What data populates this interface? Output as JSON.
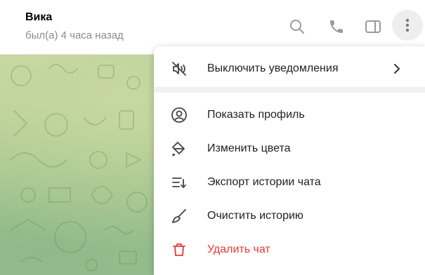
{
  "header": {
    "name": "Вика",
    "status": "был(а) 4 часа назад",
    "icons": [
      "search-icon",
      "phone-icon",
      "sidebar-icon",
      "more-vertical-icon"
    ]
  },
  "menu": {
    "items": [
      {
        "label": "Выключить уведомления",
        "icon": "bell-off-icon",
        "has_submenu": true
      },
      {
        "label": "Показать профиль",
        "icon": "profile-icon"
      },
      {
        "label": "Изменить цвета",
        "icon": "paint-bucket-icon"
      },
      {
        "label": "Экспорт истории чата",
        "icon": "export-icon"
      },
      {
        "label": "Очистить историю",
        "icon": "broom-icon"
      },
      {
        "label": "Удалить чат",
        "icon": "trash-icon",
        "danger": true
      }
    ]
  },
  "colors": {
    "danger": "#e53935",
    "icon_gray": "#8e8e8e",
    "chat_background": "#a9c88f"
  }
}
